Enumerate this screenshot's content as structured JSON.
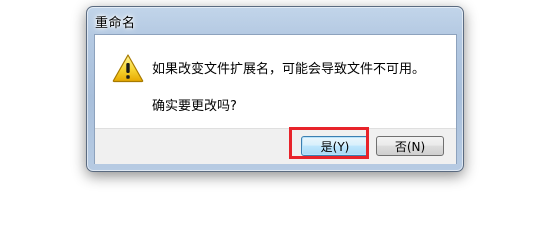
{
  "window": {
    "title": "重命名"
  },
  "dialog": {
    "icon": "warning-icon",
    "message": "如果改变文件扩展名，可能会导致文件不可用。",
    "question": "确实要更改吗?"
  },
  "buttons": {
    "yes_label": "是(Y)",
    "no_label": "否(N)"
  },
  "annotation": {
    "highlight_color": "#e8232a",
    "highlighted_target": "yes-button"
  },
  "colors": {
    "frame": "#b4c9e2",
    "button_bar": "#f0f0f0",
    "default_button_border": "#3c7fb1"
  }
}
